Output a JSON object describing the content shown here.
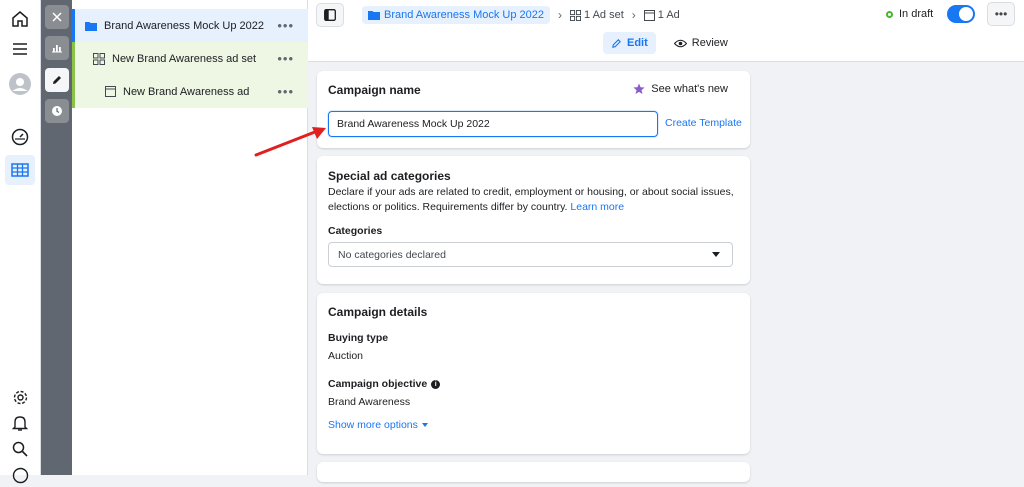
{
  "rail": {
    "icons": [
      "home-icon",
      "menu-icon",
      "avatar",
      "dashboard-icon",
      "table-icon",
      "settings-icon",
      "bell-icon",
      "search-icon",
      "help-icon"
    ]
  },
  "tools": {
    "icons": [
      "close-icon",
      "chart-icon",
      "edit-icon",
      "clock-icon"
    ]
  },
  "tree": {
    "campaign": "Brand Awareness Mock Up 2022",
    "adset": "New Brand Awareness ad set",
    "ad": "New Brand Awareness ad",
    "more": "•••"
  },
  "topbar": {
    "campaign_crumb": "Brand Awareness Mock Up 2022",
    "adset_crumb": "1 Ad set",
    "ad_crumb": "1 Ad",
    "status": "In draft",
    "more": "•••",
    "tab_edit": "Edit",
    "tab_review": "Review"
  },
  "campaign_name": {
    "title": "Campaign name",
    "whats_new": "See what's new",
    "value": "Brand Awareness Mock Up 2022",
    "create_template": "Create Template"
  },
  "special": {
    "title": "Special ad categories",
    "description": "Declare if your ads are related to credit, employment or housing, or about social issues, elections or politics. Requirements differ by country.",
    "learn_more": "Learn more",
    "categories_label": "Categories",
    "categories_value": "No categories declared"
  },
  "details": {
    "title": "Campaign details",
    "buying_type_label": "Buying type",
    "buying_type_value": "Auction",
    "objective_label": "Campaign objective",
    "objective_value": "Brand Awareness",
    "show_more": "Show more options"
  },
  "colors": {
    "accent": "#1877f2",
    "draft": "#42b72a",
    "annotation": "#e02020"
  }
}
